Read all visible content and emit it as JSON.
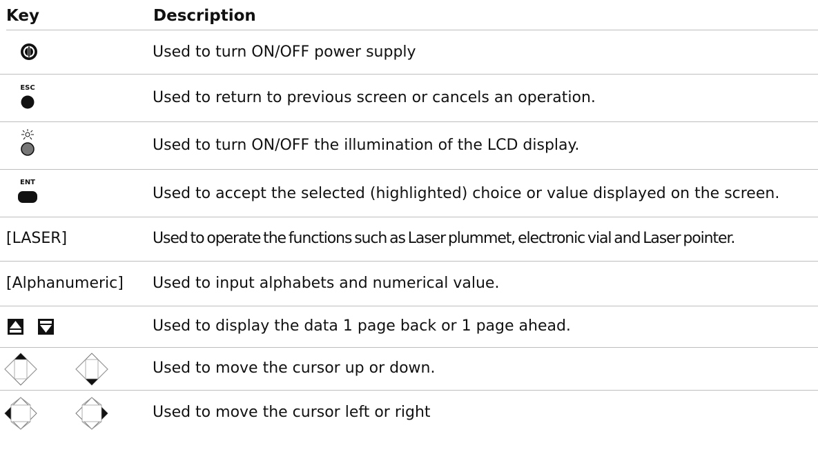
{
  "header": {
    "key": "Key",
    "description": "Description"
  },
  "rows": [
    {
      "key_icon": "power-key-icon",
      "description": "Used to turn ON/OFF power supply"
    },
    {
      "key_icon": "esc-key-icon",
      "key_text": "ESC",
      "description": "Used to return to previous screen or cancels an operation."
    },
    {
      "key_icon": "illumination-key-icon",
      "description": "Used to turn ON/OFF the illumination of the LCD display."
    },
    {
      "key_icon": "ent-key-icon",
      "key_text": "ENT",
      "description": "Used to accept the selected (highlighted) choice or value displayed on the screen."
    },
    {
      "key_text": "[LASER]",
      "description": "Used to operate the functions such as Laser plummet, electronic vial and Laser pointer."
    },
    {
      "key_text": "[Alphanumeric]",
      "description": "Used to input alphabets and numerical value."
    },
    {
      "key_icon": "page-up-down-keys-icon",
      "description": "Used to display the data 1 page back or 1 page ahead."
    },
    {
      "key_icon": "cursor-up-down-keys-icon",
      "description": "Used to move the cursor up or down."
    },
    {
      "key_icon": "cursor-left-right-keys-icon",
      "description": "Used to move the cursor left or right"
    }
  ]
}
